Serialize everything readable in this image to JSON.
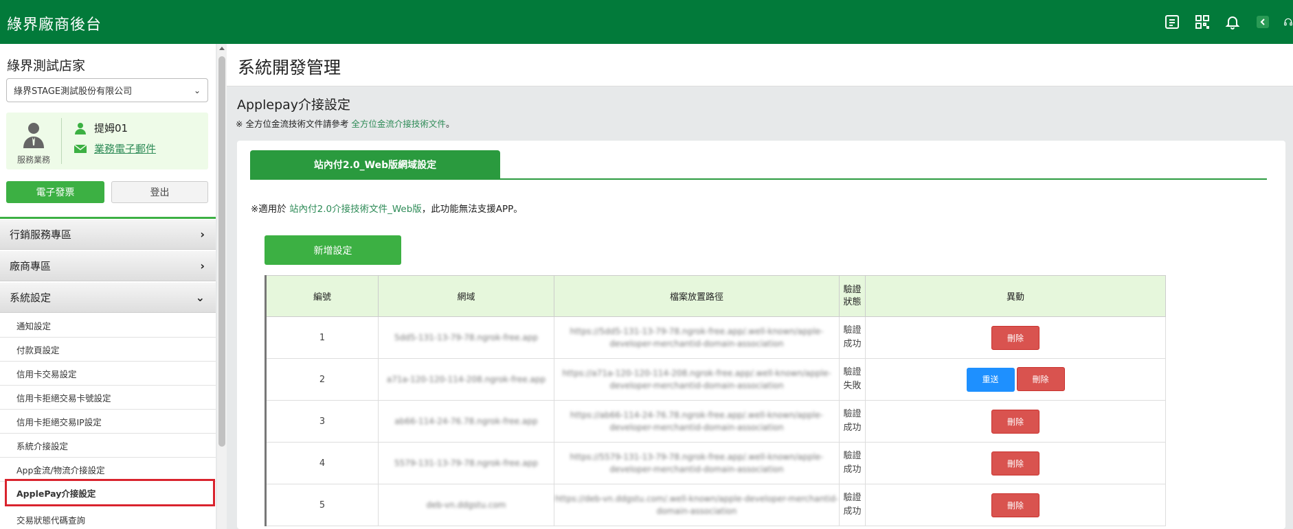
{
  "app": {
    "title": "綠界廠商後台"
  },
  "sidebar": {
    "store_name": "綠界測試店家",
    "company_select": "綠界STAGE測試股份有限公司",
    "user": {
      "role": "服務業務",
      "name": "提姆01",
      "email_link": "業務電子郵件"
    },
    "btn_invoice": "電子發票",
    "btn_logout": "登出",
    "sections": [
      {
        "label": "行銷服務專區",
        "expanded": false
      },
      {
        "label": "廠商專區",
        "expanded": false
      },
      {
        "label": "系統設定",
        "expanded": true
      }
    ],
    "items": [
      {
        "label": "通知設定"
      },
      {
        "label": "付款頁設定"
      },
      {
        "label": "信用卡交易設定"
      },
      {
        "label": "信用卡拒絕交易卡號設定"
      },
      {
        "label": "信用卡拒絕交易IP設定"
      },
      {
        "label": "系統介接設定"
      },
      {
        "label": "App金流/物流介接設定"
      },
      {
        "label": "ApplePay介接設定",
        "active": true
      },
      {
        "label": "交易狀態代碼查詢"
      }
    ]
  },
  "page": {
    "title": "系統開發管理",
    "section_title": "Applepay介接設定",
    "note_prefix": "※ 全方位金流技術文件請參考 ",
    "note_link": "全方位金流介接技術文件",
    "note_suffix": "。",
    "tab_label": "站內付2.0_Web版網域設定",
    "card_note_prefix": "※適用於 ",
    "card_note_link": "站內付2.0介接技術文件_Web版",
    "card_note_suffix": "，此功能無法支援APP。",
    "add_button": "新增設定"
  },
  "table": {
    "headers": {
      "no": "編號",
      "domain": "網域",
      "path": "檔案放置路徑",
      "status": "驗證狀態",
      "action": "異動"
    },
    "rows": [
      {
        "no": "1",
        "domain": "5dd5-131-13-79-78.ngrok-free.app",
        "path1": "https://5dd5-131-13-79-78.ngrok-free.app/.well-known/apple-",
        "path2": "developer-merchantid-domain-association",
        "status": "驗證成功",
        "resend": "",
        "delete": "刪除"
      },
      {
        "no": "2",
        "domain": "a71a-120-120-114-208.ngrok-free.app",
        "path1": "https://a71a-120-120-114-208.ngrok-free.app/.well-known/apple-",
        "path2": "developer-merchantid-domain-association",
        "status": "驗證失敗",
        "resend": "重送",
        "delete": "刪除"
      },
      {
        "no": "3",
        "domain": "ab66-114-24-76.78.ngrok-free.app",
        "path1": "https://ab66-114-24-76.78.ngrok-free.app/.well-known/apple-",
        "path2": "developer-merchantid-domain-association",
        "status": "驗證成功",
        "resend": "",
        "delete": "刪除"
      },
      {
        "no": "4",
        "domain": "5579-131-13-79-78.ngrok-free.app",
        "path1": "https://5579-131-13-79-78.ngrok-free.app/.well-known/apple-",
        "path2": "developer-merchantid-domain-association",
        "status": "驗證成功",
        "resend": "",
        "delete": "刪除"
      },
      {
        "no": "5",
        "domain": "deb-vn.ddgstu.com",
        "path1": "https://deb-vn.ddgstu.com/.well-known/apple-developer-merchantid-",
        "path2": "domain-association",
        "status": "驗證成功",
        "resend": "",
        "delete": "刪除"
      }
    ]
  }
}
